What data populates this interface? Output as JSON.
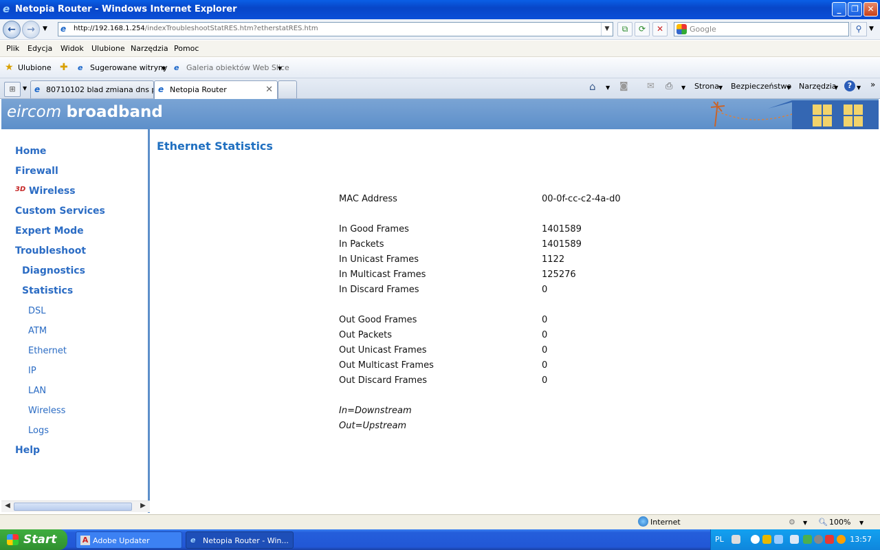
{
  "window": {
    "title": "Netopia Router - Windows Internet Explorer"
  },
  "address": {
    "url_prefix": "http://192.168.1.254",
    "url_rest": "/indexTroubleshootStatRES.htm?etherstatRES.htm"
  },
  "search": {
    "placeholder": "Google"
  },
  "menu": [
    "Plik",
    "Edycja",
    "Widok",
    "Ulubione",
    "Narzędzia",
    "Pomoc"
  ],
  "favorites": {
    "label": "Ulubione",
    "items": [
      "Sugerowane witryny",
      "Galeria obiektów Web Slice"
    ]
  },
  "tabs": [
    "80710102 blad zmiana dns p...",
    "Netopia Router"
  ],
  "commands": [
    "Strona",
    "Bezpieczeństwo",
    "Narzędzia"
  ],
  "banner": {
    "brand_light": "eircom",
    "brand_bold": "broadband"
  },
  "nav": {
    "items": [
      "Home",
      "Firewall",
      "Wireless",
      "Custom Services",
      "Expert Mode",
      "Troubleshoot"
    ],
    "sub": [
      "Diagnostics",
      "Statistics"
    ],
    "stats": [
      "DSL",
      "ATM",
      "Ethernet",
      "IP",
      "LAN",
      "Wireless",
      "Logs"
    ],
    "help": "Help"
  },
  "page": {
    "title": "Ethernet Statistics",
    "mac": {
      "label": "MAC Address",
      "value": "00-0f-cc-c2-4a-d0"
    },
    "in_rows": [
      {
        "label": "In Good Frames",
        "value": "1401589"
      },
      {
        "label": "In Packets",
        "value": "1401589"
      },
      {
        "label": "In Unicast Frames",
        "value": "1122"
      },
      {
        "label": "In Multicast Frames",
        "value": "125276"
      },
      {
        "label": "In Discard Frames",
        "value": "0"
      }
    ],
    "out_rows": [
      {
        "label": "Out Good Frames",
        "value": "0"
      },
      {
        "label": "Out Packets",
        "value": "0"
      },
      {
        "label": "Out Unicast Frames",
        "value": "0"
      },
      {
        "label": "Out Multicast Frames",
        "value": "0"
      },
      {
        "label": "Out Discard Frames",
        "value": "0"
      }
    ],
    "notes": [
      "In=Downstream",
      "Out=Upstream"
    ]
  },
  "status": {
    "zone": "Internet",
    "zoom": "100%"
  },
  "taskbar": {
    "start": "Start",
    "tasks": [
      "Adobe Updater",
      "Netopia Router - Win..."
    ],
    "lang": "PL",
    "clock": "13:57"
  }
}
